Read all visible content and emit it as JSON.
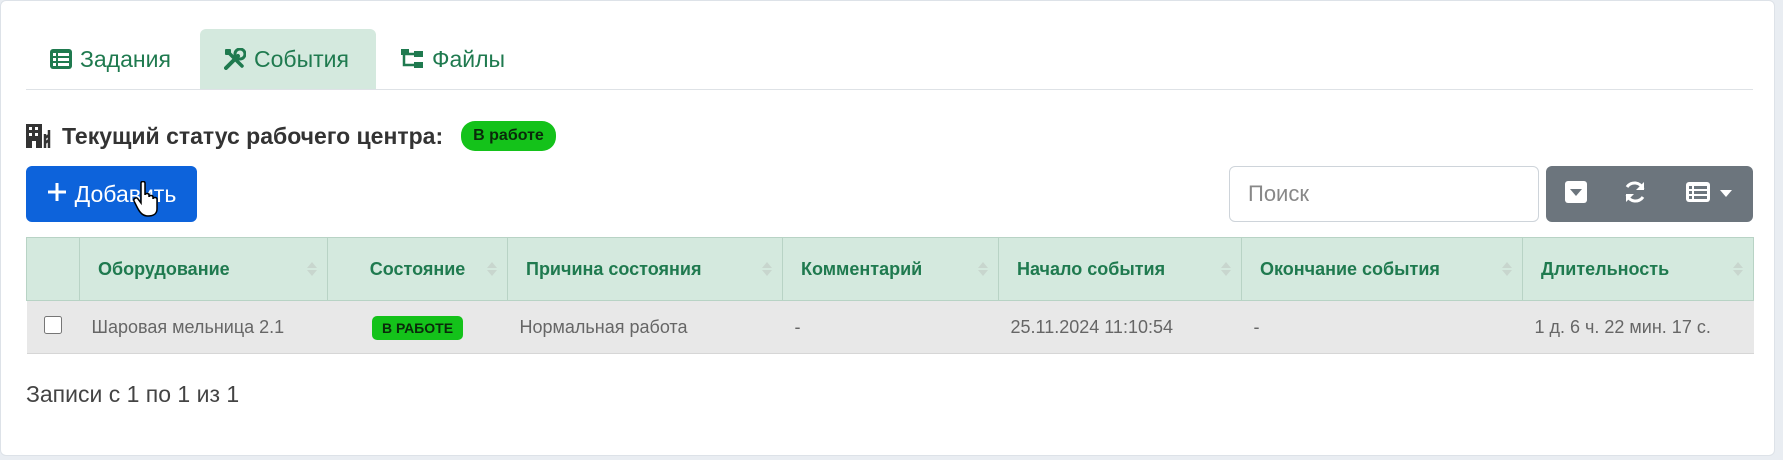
{
  "tabs": [
    {
      "label": "Задания",
      "icon": "list-icon",
      "active": false
    },
    {
      "label": "События",
      "icon": "tools-icon",
      "active": true
    },
    {
      "label": "Файлы",
      "icon": "diagram-icon",
      "active": false
    }
  ],
  "status": {
    "label": "Текущий статус рабочего центра:",
    "badge": "В работе",
    "icon": "building-icon"
  },
  "toolbar": {
    "add_label": "Добавить",
    "search_placeholder": "Поиск",
    "collapse_icon": "caret-square-down-icon",
    "refresh_icon": "refresh-icon",
    "columns_icon": "list-columns-icon"
  },
  "table": {
    "headers": [
      "Оборудование",
      "Состояние",
      "Причина состояния",
      "Комментарий",
      "Начало события",
      "Окончание события",
      "Длительность"
    ],
    "rows": [
      {
        "equipment": "Шаровая мельница 2.1",
        "state": "В РАБОТЕ",
        "reason": "Нормальная работа",
        "comment": "-",
        "start": "25.11.2024 11:10:54",
        "end": "-",
        "duration": "1 д. 6 ч. 22 мин. 17 с."
      }
    ]
  },
  "footer": {
    "records_info": "Записи с 1 по 1 из 1"
  },
  "colors": {
    "accent": "#1f7a4f",
    "primary_button": "#0d63db",
    "status_green": "#14c21a",
    "tool_gray": "#6c757d",
    "header_bg": "#d4e9de"
  }
}
